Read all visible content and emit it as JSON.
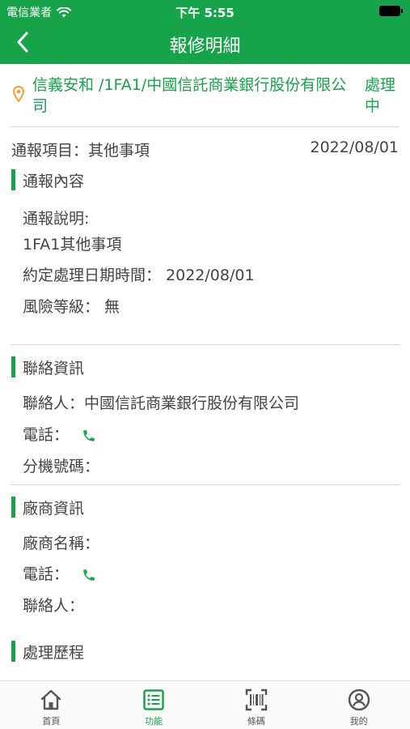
{
  "status_bar": {
    "carrier": "電信業者",
    "time": "下午 5:55"
  },
  "nav": {
    "title": "報修明細"
  },
  "report": {
    "site": "信義安和 /1FA1/中國信託商業銀行股份有限公司",
    "status": "處理中",
    "item_line": "通報項目：其他事項",
    "date": "2022/08/01"
  },
  "content_section": {
    "title": "通報內容",
    "desc_label": "通報說明:",
    "desc_value": "1FA1其他事項",
    "appointment_line": "約定處理日期時間： 2022/08/01",
    "risk_line": "風險等級： 無"
  },
  "contact_section": {
    "title": "聯絡資訊",
    "contact_line": "聯絡人：中國信託商業銀行股份有限公司",
    "phone_label": "電話：",
    "extension_label": "分機號碼："
  },
  "vendor_section": {
    "title": "廠商資訊",
    "name_label": "廠商名稱：",
    "phone_label": "電話：",
    "contact_label": "聯絡人："
  },
  "history_section": {
    "title": "處理歷程"
  },
  "tabs": [
    {
      "label": "首頁",
      "icon": "home-icon",
      "active": false
    },
    {
      "label": "功能",
      "icon": "list-icon",
      "active": true
    },
    {
      "label": "條碼",
      "icon": "barcode-icon",
      "active": false
    },
    {
      "label": "我的",
      "icon": "user-icon",
      "active": false
    }
  ],
  "colors": {
    "brand": "#16a34a",
    "location_pin": "#f59e2b"
  }
}
